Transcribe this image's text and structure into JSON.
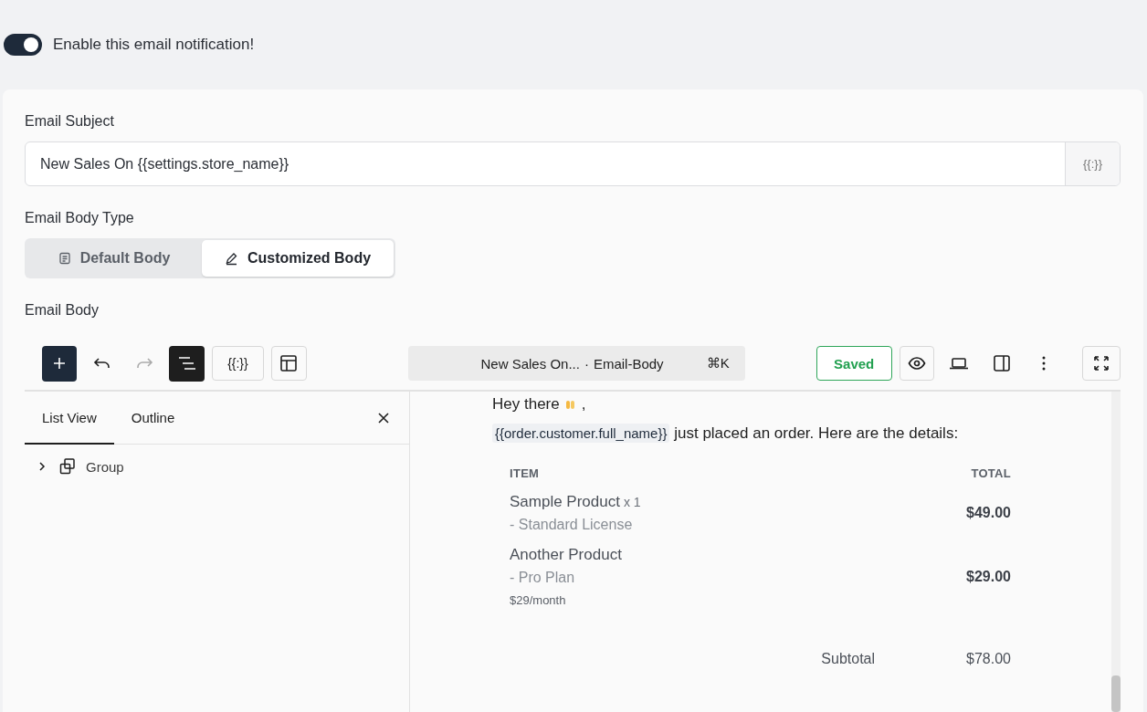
{
  "notification": {
    "on": true,
    "label": "Enable this email notification!"
  },
  "subject": {
    "label": "Email Subject",
    "value": "New Sales On {{settings.store_name}}",
    "tag_button": "{{:}}"
  },
  "body_type": {
    "label": "Email Body Type",
    "options": [
      {
        "label": "Default Body",
        "kind": "document",
        "selected": false
      },
      {
        "label": "Customized Body",
        "kind": "pen",
        "selected": true
      }
    ]
  },
  "email_body": {
    "label": "Email Body",
    "toolbar": {
      "tag_button": "{{:}}",
      "command": {
        "title": "New Sales On...",
        "separator": "·",
        "context": "Email-Body",
        "shortcut": "⌘K"
      },
      "status": "Saved"
    },
    "panel": {
      "tabs": [
        {
          "label": "List View",
          "selected": true
        },
        {
          "label": "Outline",
          "selected": false
        }
      ],
      "tree": [
        {
          "label": "Group",
          "expanded": false
        }
      ]
    },
    "preview": {
      "greeting": "Hey there",
      "greeting_end": ",",
      "variable": "{{order.customer.full_name}}",
      "intro": "just placed an order. Here are the details:",
      "columns": [
        "ITEM",
        "TOTAL"
      ],
      "rows": [
        {
          "name": "Sample Product",
          "qty": "x 1",
          "details": [
            "- Standard License"
          ],
          "note": "",
          "total": "$49.00"
        },
        {
          "name": "Another Product",
          "qty": "",
          "details": [
            "- Pro Plan"
          ],
          "note": "$29/month",
          "total": "$29.00"
        }
      ],
      "subtotal": {
        "label": "Subtotal",
        "value": "$78.00"
      }
    }
  }
}
